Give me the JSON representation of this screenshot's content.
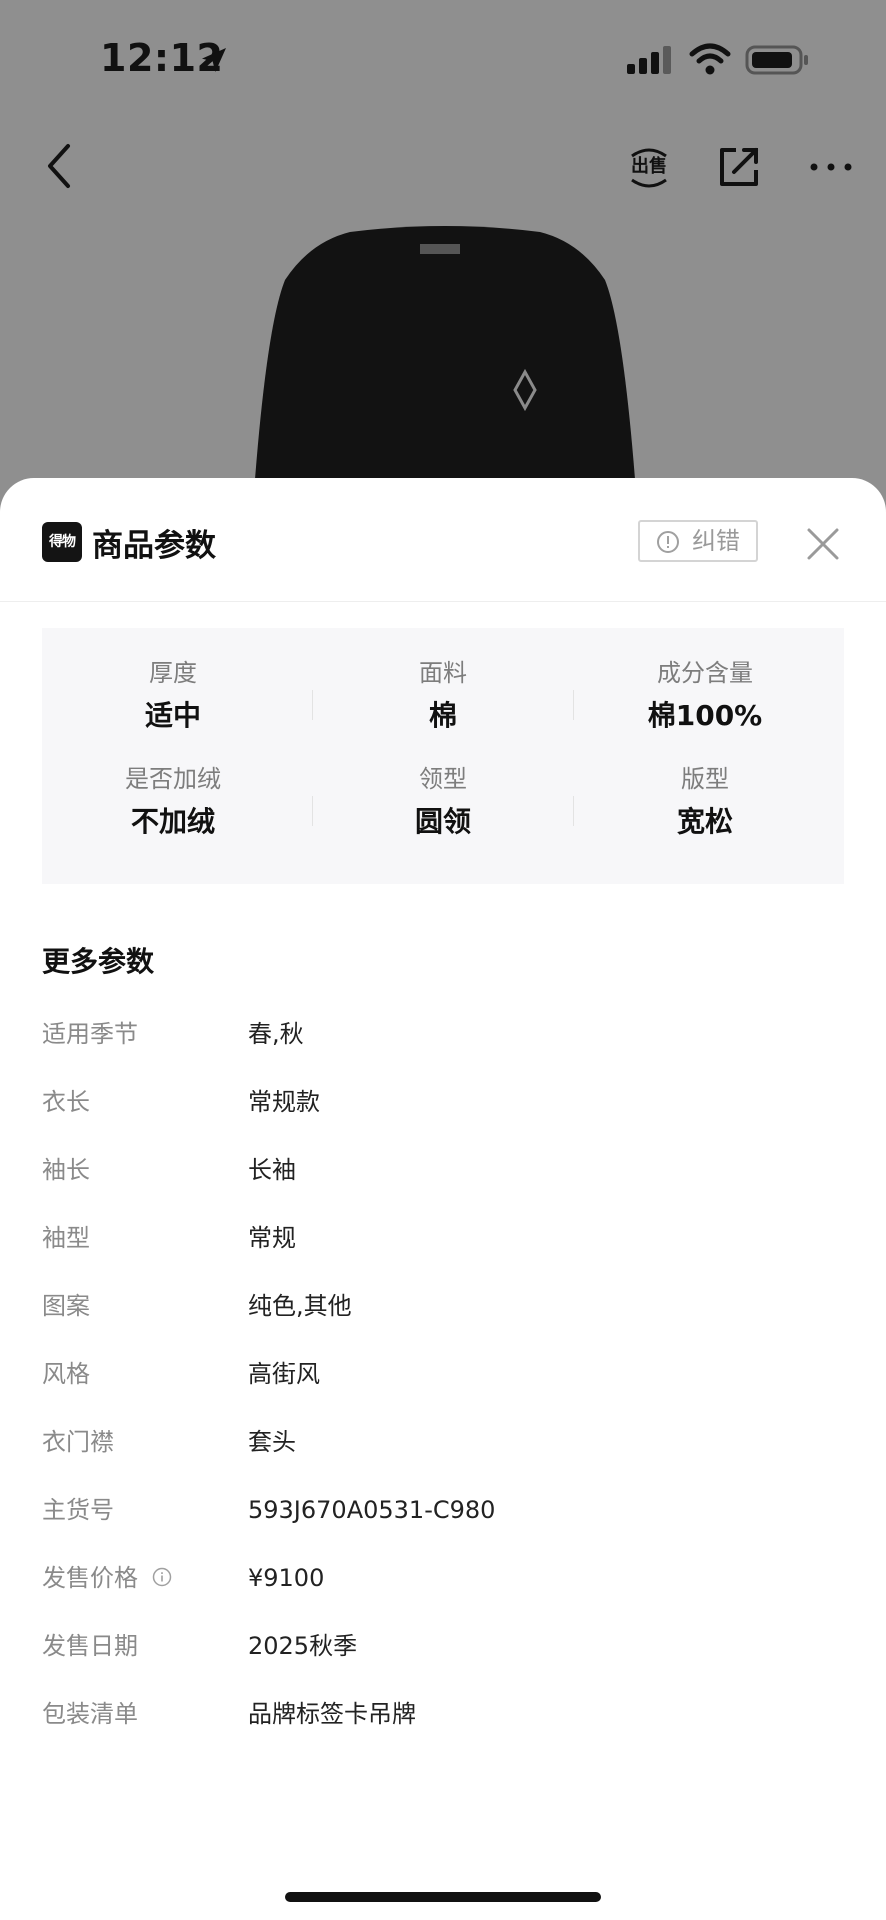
{
  "status_bar": {
    "time": "12:12"
  },
  "sheet": {
    "logo_text": "得物",
    "title": "商品参数",
    "report_label": "纠错"
  },
  "key_params": [
    {
      "label": "厚度",
      "value": "适中"
    },
    {
      "label": "面料",
      "value": "棉"
    },
    {
      "label": "成分含量",
      "value": "棉100%"
    },
    {
      "label": "是否加绒",
      "value": "不加绒"
    },
    {
      "label": "领型",
      "value": "圆领"
    },
    {
      "label": "版型",
      "value": "宽松"
    }
  ],
  "more_params_title": "更多参数",
  "more_params": [
    {
      "label": "适用季节",
      "value": "春,秋"
    },
    {
      "label": "衣长",
      "value": "常规款"
    },
    {
      "label": "袖长",
      "value": "长袖"
    },
    {
      "label": "袖型",
      "value": "常规"
    },
    {
      "label": "图案",
      "value": "纯色,其他"
    },
    {
      "label": "风格",
      "value": "高街风"
    },
    {
      "label": "衣门襟",
      "value": "套头"
    },
    {
      "label": "主货号",
      "value": "593J670A0531-C980"
    },
    {
      "label": "发售价格",
      "value": "¥9100"
    },
    {
      "label": "发售日期",
      "value": "2025秋季"
    },
    {
      "label": "包装清单",
      "value": "品牌标签卡吊牌"
    }
  ],
  "icons": {
    "back": "back-arrow-icon",
    "sell": "sell-icon",
    "share": "share-icon",
    "more": "more-icon",
    "close": "close-icon",
    "alert": "alert-circle-icon",
    "info": "info-icon"
  }
}
